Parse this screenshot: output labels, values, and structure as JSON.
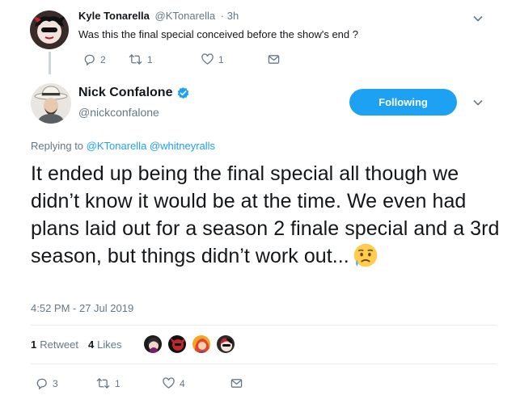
{
  "parent_tweet": {
    "name": "Kyle Tonarella",
    "handle": "@KTonarella",
    "time": "· 3h",
    "text": "Was this the final special conceived before the show's end ?",
    "avatar_icon": "harley-quinn-avatar",
    "actions": {
      "replies": "2",
      "retweets": "1",
      "likes": "1"
    }
  },
  "main_tweet": {
    "name": "Nick Confalone",
    "handle": "@nickconfalone",
    "avatar_icon": "cowboy-hat-avatar",
    "follow_label": "Following",
    "replying_prefix": "Replying to",
    "replying_to": [
      "@KTonarella",
      "@whitneyralls"
    ],
    "text": "It ended up being the final special all though we didn’t know it would be at the time. We even had plans laid out for a season 2 finale special and a 3rd season, but things didn’t work out...",
    "emoji": "sad-but-relieved-face",
    "timestamp": "4:52 PM - 27 Jul 2019",
    "retweet_count": "1",
    "retweet_label": "Retweet",
    "like_count": "4",
    "like_label": "Likes",
    "actions": {
      "replies": "3",
      "retweets": "1",
      "likes": "4"
    }
  },
  "colors": {
    "accent": "#1da1f2",
    "secondary_text": "#657786",
    "primary_text": "#14171a",
    "divider": "#e6ecf0"
  }
}
